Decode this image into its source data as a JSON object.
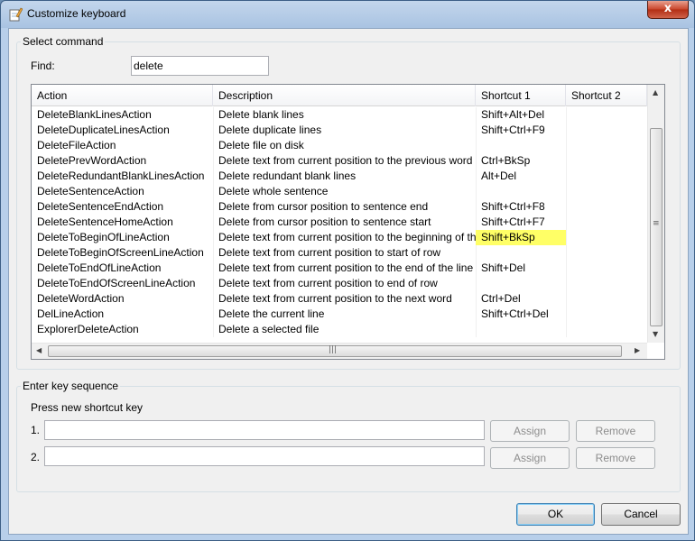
{
  "window": {
    "title": "Customize keyboard",
    "close_label": "x"
  },
  "select_command": {
    "group_label": "Select command",
    "find_label": "Find:",
    "find_value": "delete"
  },
  "table": {
    "columns": [
      "Action",
      "Description",
      "Shortcut 1",
      "Shortcut 2"
    ],
    "rows": [
      {
        "action": "DeleteBlankLinesAction",
        "description": "Delete blank lines",
        "shortcut1": "Shift+Alt+Del",
        "shortcut2": ""
      },
      {
        "action": "DeleteDuplicateLinesAction",
        "description": "Delete duplicate lines",
        "shortcut1": "Shift+Ctrl+F9",
        "shortcut2": ""
      },
      {
        "action": "DeleteFileAction",
        "description": "Delete file on disk",
        "shortcut1": "",
        "shortcut2": ""
      },
      {
        "action": "DeletePrevWordAction",
        "description": "Delete text from current position to the previous word",
        "shortcut1": "Ctrl+BkSp",
        "shortcut2": ""
      },
      {
        "action": "DeleteRedundantBlankLinesAction",
        "description": "Delete redundant blank lines",
        "shortcut1": "Alt+Del",
        "shortcut2": ""
      },
      {
        "action": "DeleteSentenceAction",
        "description": "Delete whole sentence",
        "shortcut1": "",
        "shortcut2": ""
      },
      {
        "action": "DeleteSentenceEndAction",
        "description": "Delete from cursor position to sentence end",
        "shortcut1": "Shift+Ctrl+F8",
        "shortcut2": ""
      },
      {
        "action": "DeleteSentenceHomeAction",
        "description": "Delete from cursor position to sentence start",
        "shortcut1": "Shift+Ctrl+F7",
        "shortcut2": ""
      },
      {
        "action": "DeleteToBeginOfLineAction",
        "description": "Delete text from current position to the beginning of the line",
        "shortcut1": "Shift+BkSp",
        "shortcut2": "",
        "highlight": true
      },
      {
        "action": "DeleteToBeginOfScreenLineAction",
        "description": "Delete text from current position to start of row",
        "shortcut1": "",
        "shortcut2": ""
      },
      {
        "action": "DeleteToEndOfLineAction",
        "description": "Delete text from current position to the end of the line",
        "shortcut1": "Shift+Del",
        "shortcut2": ""
      },
      {
        "action": "DeleteToEndOfScreenLineAction",
        "description": "Delete text from current position to end of row",
        "shortcut1": "",
        "shortcut2": ""
      },
      {
        "action": "DeleteWordAction",
        "description": "Delete text from current position to the next word",
        "shortcut1": "Ctrl+Del",
        "shortcut2": ""
      },
      {
        "action": "DelLineAction",
        "description": "Delete the current line",
        "shortcut1": "Shift+Ctrl+Del",
        "shortcut2": ""
      },
      {
        "action": "ExplorerDeleteAction",
        "description": "Delete a selected file",
        "shortcut1": "",
        "shortcut2": ""
      }
    ],
    "highlight_color": "#ffff66"
  },
  "key_sequence": {
    "group_label": "Enter key sequence",
    "prompt": "Press new shortcut key",
    "rows": [
      {
        "number": "1.",
        "value": "",
        "assign_label": "Assign",
        "remove_label": "Remove"
      },
      {
        "number": "2.",
        "value": "",
        "assign_label": "Assign",
        "remove_label": "Remove"
      }
    ]
  },
  "footer": {
    "ok_label": "OK",
    "cancel_label": "Cancel"
  }
}
